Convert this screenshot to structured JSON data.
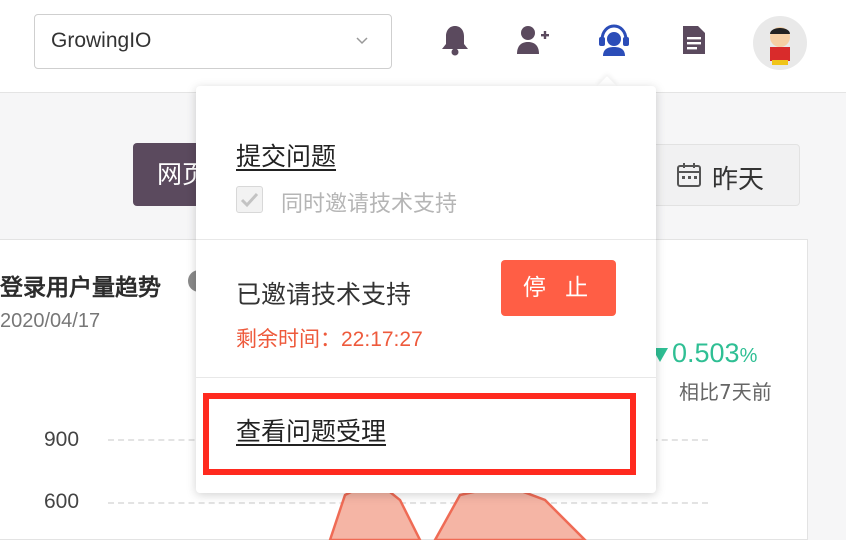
{
  "header": {
    "project_select_value": "GrowingIO",
    "icons": [
      "bell-icon",
      "add-user-icon",
      "support-headset-icon",
      "document-icon"
    ],
    "avatar": "user-avatar"
  },
  "background": {
    "web_button_label": "网页",
    "date_button_label": "昨天",
    "card": {
      "title": "登录用户量趋势",
      "date": "2020/04/17",
      "kpi_value": "0.503",
      "kpi_unit": "%",
      "kpi_compare": "相比7天前",
      "kpi_color": "#2fbf94",
      "y_ticks": [
        "900",
        "600"
      ]
    }
  },
  "support_menu": {
    "submit_issue": "提交问题",
    "invite_support_checkbox": "同时邀请技术支持",
    "invite_support_checked": true,
    "status_text": "已邀请技术支持",
    "stop_button": "停 止",
    "remaining_label": "剩余时间：",
    "remaining_time": "22:17:27",
    "view_tickets": "查看问题受理",
    "accent_color": "#ff5e45"
  }
}
